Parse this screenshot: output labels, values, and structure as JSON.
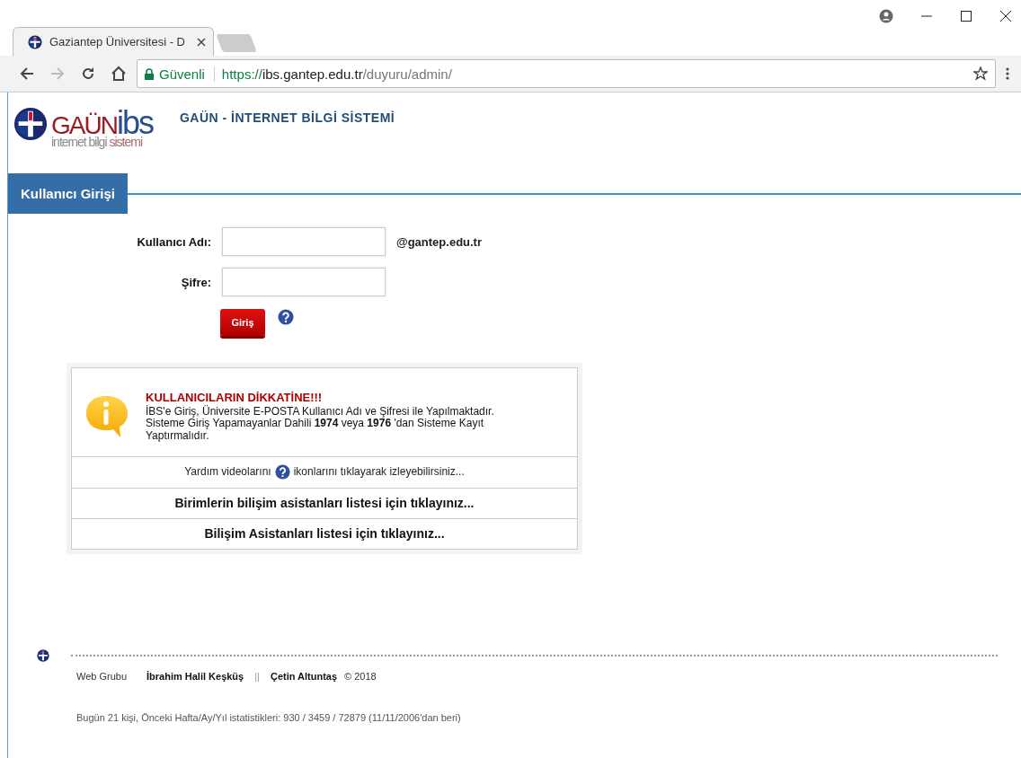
{
  "browser": {
    "tab": {
      "title": "Gaziantep Üniversitesi - D",
      "selected": true
    },
    "address": {
      "secure_label": "Güvenli",
      "scheme": "https://",
      "host": "ibs.gantep.edu.tr",
      "path": "/duyuru/admin/"
    }
  },
  "header": {
    "logo": {
      "brand": "GAÜN",
      "mark": "ibs",
      "tagline_1": "internet bilgi",
      "tagline_2": "sistemi"
    },
    "title": "GAÜN - İNTERNET BİLGİ SİSTEMİ"
  },
  "section_title": "Kullanıcı Girişi",
  "login": {
    "fields": [
      {
        "label": "Kullanıcı Adı:",
        "suffix": "@gantep.edu.tr"
      },
      {
        "label": "Şifre:"
      }
    ],
    "submit": "Giriş"
  },
  "notice": {
    "title": "KULLANICILARIN DİKKATİNE!!!",
    "lines": [
      "İBS'e Giriş, Üniversite E-POSTA Kullanıcı Adı ve Şifresi ile Yapılmaktadır.",
      "Sisteme Giriş Yapamayanlar Dahili **1974** veya **1976** 'dan Sisteme Kayıt Yaptırmalıdır."
    ],
    "help_before": "Yardım videolarını",
    "help_after": "ikonlarını tıklayarak izleyebilirsiniz...",
    "links": [
      "Birimlerin bilişim asistanları listesi için tıklayınız...",
      "Bilişim Asistanları listesi için tıklayınız..."
    ]
  },
  "footer": {
    "group_label": "Web Grubu",
    "authors": [
      "İbrahim Halil Keşküş",
      "Çetin Altuntaş"
    ],
    "separator": "||",
    "copyright": "© 2018",
    "stats": "Bugün 21 kişi, Önceki Hafta/Ay/Yıl istatistikleri: 930 / 3459 / 72879 (11/11/2006'dan beri)"
  }
}
